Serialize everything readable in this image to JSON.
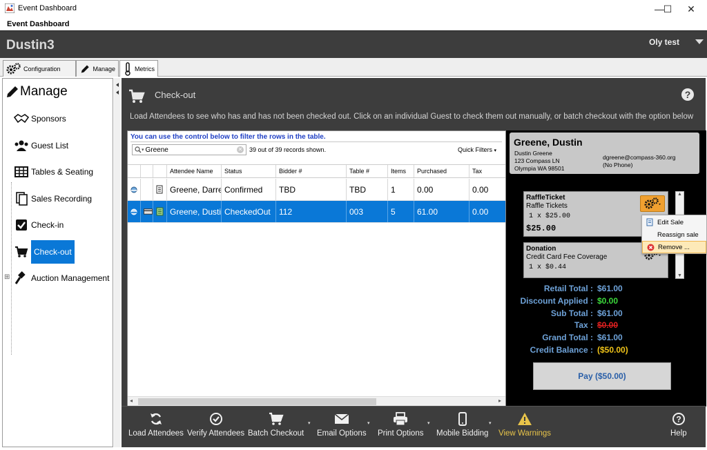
{
  "window": {
    "title": "Event Dashboard",
    "menu_title": "Event Dashboard",
    "minimize": "—",
    "maximize": "☐",
    "close": "✕"
  },
  "header": {
    "event_name": "Dustin3",
    "user": "Oly test"
  },
  "tabs": [
    {
      "label": "Configuration"
    },
    {
      "label": "Manage"
    },
    {
      "label": "Metrics"
    }
  ],
  "sidebar": {
    "title": "Manage",
    "items": [
      {
        "label": "Sponsors"
      },
      {
        "label": "Guest List"
      },
      {
        "label": "Tables & Seating"
      },
      {
        "label": "Sales Recording"
      },
      {
        "label": "Check-in"
      },
      {
        "label": "Check-out"
      },
      {
        "label": "Auction Management"
      }
    ],
    "expand_symbol": "⊞"
  },
  "main": {
    "title": "Check-out",
    "help": "?",
    "instructions": "Load Attendees to see who has and has not been checked out. Click on an individual Guest to check them out manually, or batch checkout with the option below"
  },
  "grid": {
    "filter_note": "You can use the control below to filter the rows in the table.",
    "search_value": "Greene",
    "records_text": "39 out of 39 records shown.",
    "quick_filters": "Quick Filters",
    "columns": [
      "Attendee Name",
      "Status",
      "Bidder #",
      "Table #",
      "Items",
      "Purchased",
      "Tax"
    ],
    "rows": [
      {
        "name": "Greene, Darren",
        "status": "Confirmed",
        "bidder": "TBD",
        "table": "TBD",
        "items": "1",
        "purchased": "0.00",
        "tax": "0.00",
        "selected": false
      },
      {
        "name": "Greene, Dustin",
        "status": "CheckedOut",
        "bidder": "112",
        "table": "003",
        "items": "5",
        "purchased": "61.00",
        "tax": "0.00",
        "selected": true
      }
    ]
  },
  "detail": {
    "name": "Greene, Dustin",
    "addr1": "Dustin Greene",
    "addr2": "123 Compass LN",
    "addr3": "Olympia WA 98501",
    "email": "dgreene@compass-360.org",
    "phone": "(No Phone)",
    "items": [
      {
        "title": "RaffleTicket",
        "sub": "Raffle Tickets",
        "qty": "1 x  $25.00",
        "price": "$25.00"
      },
      {
        "title": "Donation",
        "sub": "Credit Card Fee Coverage",
        "qty": "1 x  $0.44"
      }
    ],
    "totals": [
      {
        "label": "Retail Total :",
        "value": "$61.00",
        "color": "#6ea2d8"
      },
      {
        "label": "Discount Applied :",
        "value": "$0.00",
        "color": "#3cd93c"
      },
      {
        "label": "Sub Total :",
        "value": "$61.00",
        "color": "#6ea2d8"
      },
      {
        "label": "Tax :",
        "value": "$0.00",
        "color": "#e02020"
      },
      {
        "label": "Grand Total :",
        "value": "$61.00",
        "color": "#6ea2d8"
      },
      {
        "label": "Credit Balance :",
        "value": "($50.00)",
        "color": "#f0c419"
      }
    ],
    "pay_label": "Pay ($50.00)"
  },
  "context_menu": {
    "items": [
      {
        "label": "Edit Sale"
      },
      {
        "label": "Reassign sale"
      },
      {
        "label": "Remove ..."
      }
    ]
  },
  "toolbar": {
    "buttons": [
      {
        "label": "Load Attendees"
      },
      {
        "label": "Verify Attendees"
      },
      {
        "label": "Batch Checkout"
      },
      {
        "label": "Email Options"
      },
      {
        "label": "Print Options"
      },
      {
        "label": "Mobile Bidding"
      },
      {
        "label": "View Warnings"
      },
      {
        "label": "Help"
      }
    ]
  },
  "colors": {
    "accent": "#0a78d7",
    "panel": "#3d3d3d",
    "warning": "#e8c44a"
  }
}
